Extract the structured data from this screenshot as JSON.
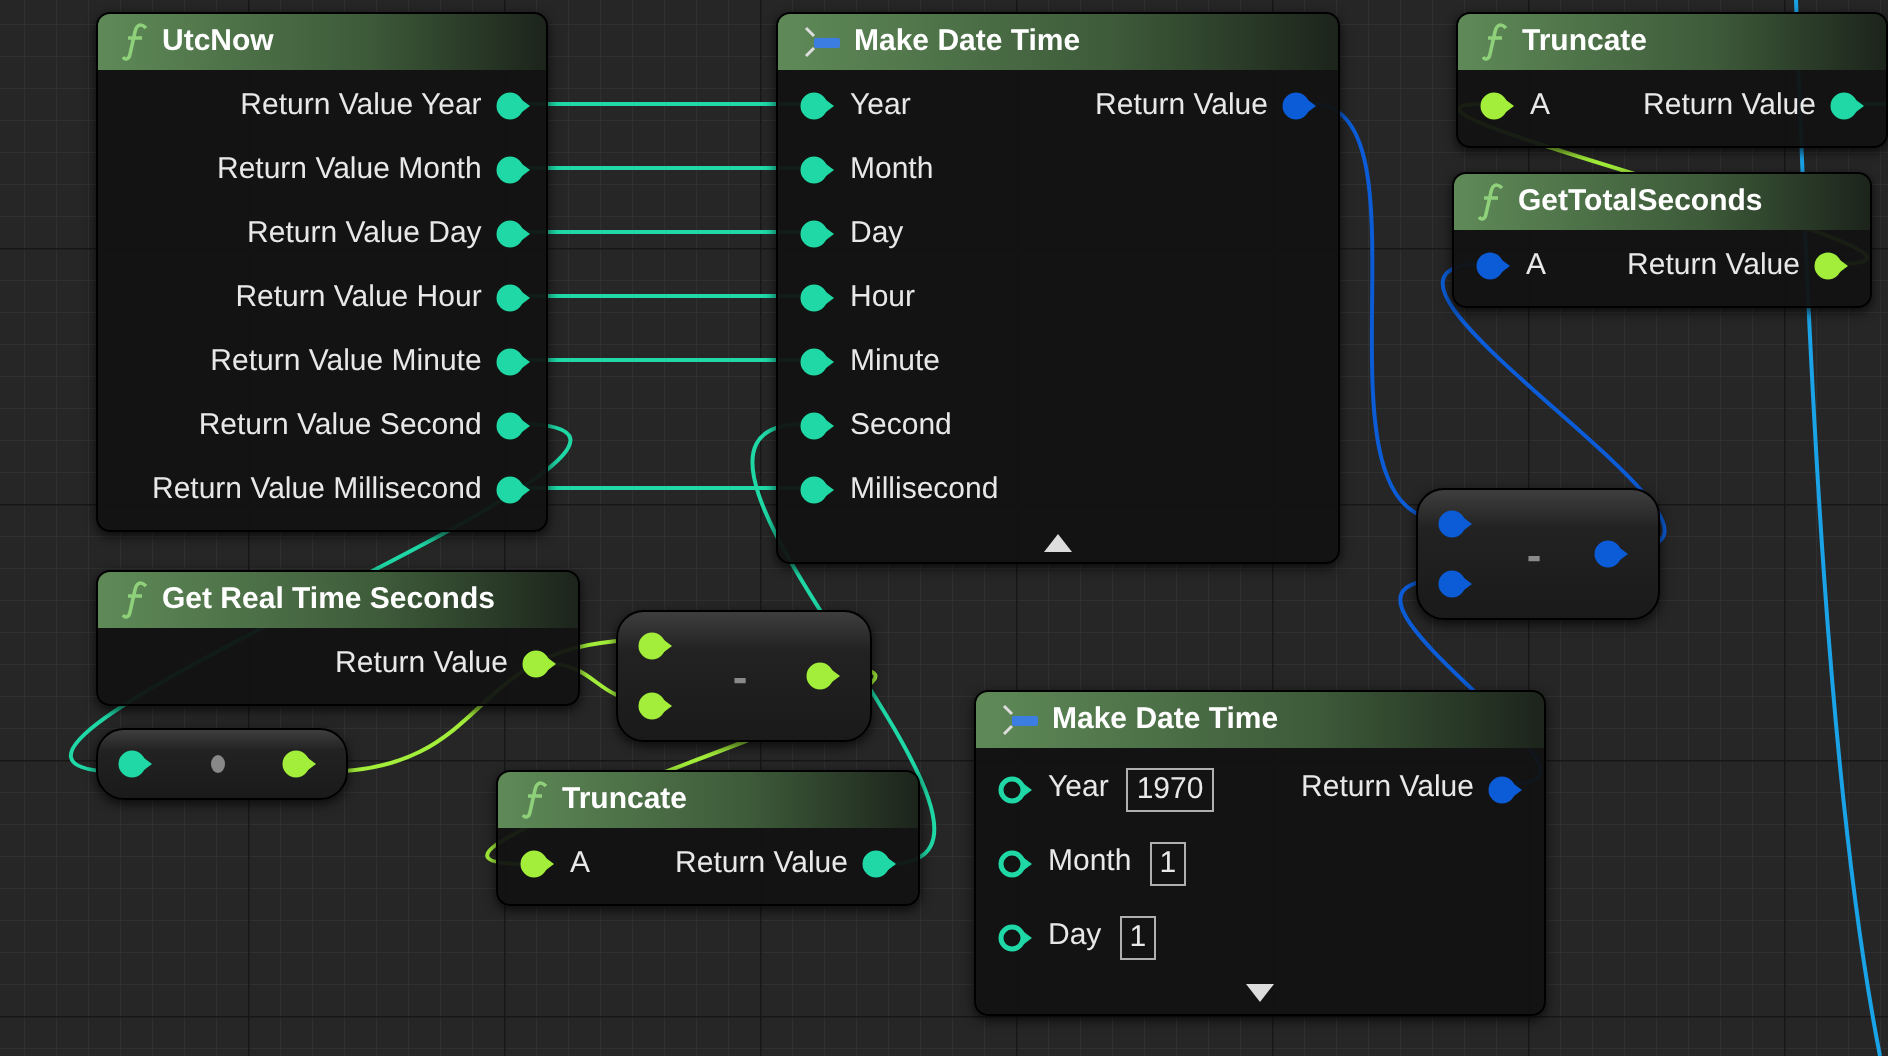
{
  "nodes": [
    {
      "kind": "function",
      "title": "UtcNow",
      "outputs": [
        {
          "label": "Return Value Year",
          "color": "#1fd8a6",
          "connected": true
        },
        {
          "label": "Return Value Month",
          "color": "#1fd8a6",
          "connected": true
        },
        {
          "label": "Return Value Day",
          "color": "#1fd8a6",
          "connected": true
        },
        {
          "label": "Return Value Hour",
          "color": "#1fd8a6",
          "connected": true
        },
        {
          "label": "Return Value Minute",
          "color": "#1fd8a6",
          "connected": true
        },
        {
          "label": "Return Value Second",
          "color": "#1fd8a6",
          "connected": true
        },
        {
          "label": "Return Value Millisecond",
          "color": "#1fd8a6",
          "connected": true
        }
      ]
    },
    {
      "kind": "make",
      "title": "Make Date Time",
      "expanded": true,
      "inputs": [
        {
          "label": "Year",
          "color": "#1fd8a6",
          "connected": true
        },
        {
          "label": "Month",
          "color": "#1fd8a6",
          "connected": true
        },
        {
          "label": "Day",
          "color": "#1fd8a6",
          "connected": true
        },
        {
          "label": "Hour",
          "color": "#1fd8a6",
          "connected": true
        },
        {
          "label": "Minute",
          "color": "#1fd8a6",
          "connected": true
        },
        {
          "label": "Second",
          "color": "#1fd8a6",
          "connected": true
        },
        {
          "label": "Millisecond",
          "color": "#1fd8a6",
          "connected": true
        }
      ],
      "outputs": [
        {
          "label": "Return Value",
          "color": "#0b5cd6",
          "connected": true
        }
      ]
    },
    {
      "kind": "function",
      "title": "Truncate",
      "inputs": [
        {
          "label": "A",
          "color": "#a3ee3a",
          "connected": true
        }
      ],
      "outputs": [
        {
          "label": "Return Value",
          "color": "#1fd8a6",
          "connected": true
        }
      ]
    },
    {
      "kind": "function",
      "title": "GetTotalSeconds",
      "inputs": [
        {
          "label": "A",
          "color": "#0b5cd6",
          "connected": true
        }
      ],
      "outputs": [
        {
          "label": "Return Value",
          "color": "#a3ee3a",
          "connected": true
        }
      ]
    },
    {
      "kind": "operator",
      "symbol": "-",
      "inputs": [
        {
          "color": "#0b5cd6",
          "connected": true
        },
        {
          "color": "#0b5cd6",
          "connected": true
        }
      ],
      "outputs": [
        {
          "color": "#0b5cd6",
          "connected": true
        }
      ]
    },
    {
      "kind": "function",
      "title": "Get Real Time Seconds",
      "outputs": [
        {
          "label": "Return Value",
          "color": "#a3ee3a",
          "connected": true
        }
      ]
    },
    {
      "kind": "operator",
      "symbol": "-",
      "inputs": [
        {
          "color": "#a3ee3a",
          "connected": true
        },
        {
          "color": "#a3ee3a",
          "connected": true
        }
      ],
      "outputs": [
        {
          "color": "#a3ee3a",
          "connected": true
        }
      ]
    },
    {
      "kind": "conversion",
      "inputs": [
        {
          "color": "#1fd8a6",
          "connected": true
        }
      ],
      "outputs": [
        {
          "color": "#a3ee3a",
          "connected": true
        }
      ]
    },
    {
      "kind": "function",
      "title": "Truncate",
      "inputs": [
        {
          "label": "A",
          "color": "#a3ee3a",
          "connected": true
        }
      ],
      "outputs": [
        {
          "label": "Return Value",
          "color": "#1fd8a6",
          "connected": true
        }
      ]
    },
    {
      "kind": "make",
      "title": "Make Date Time",
      "expanded": false,
      "inputs": [
        {
          "label": "Year",
          "color": "#1fd8a6",
          "connected": false,
          "value": "1970"
        },
        {
          "label": "Month",
          "color": "#1fd8a6",
          "connected": false,
          "value": "1"
        },
        {
          "label": "Day",
          "color": "#1fd8a6",
          "connected": false,
          "value": "1"
        }
      ],
      "outputs": [
        {
          "label": "Return Value",
          "color": "#0b5cd6",
          "connected": true
        }
      ]
    }
  ]
}
